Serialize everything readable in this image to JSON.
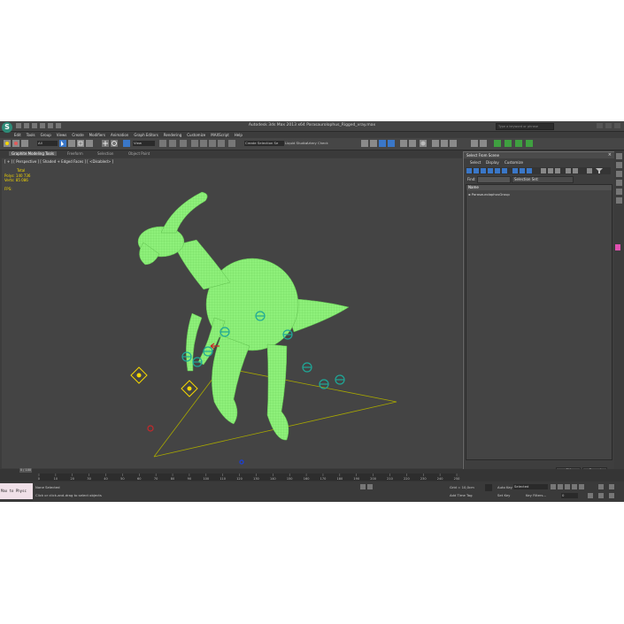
{
  "window": {
    "title": "Autodesk 3ds Max 2013 x64   Parasaurolophus_Rigged_vray.max",
    "search_placeholder": "Type a keyword or phrase"
  },
  "menu": [
    "Edit",
    "Tools",
    "Group",
    "Views",
    "Create",
    "Modifiers",
    "Animation",
    "Graph Editors",
    "Rendering",
    "Customize",
    "MAXScript",
    "Help"
  ],
  "toolbar": {
    "selection_filter": "All",
    "reference_coord": "View",
    "named_selection": "Create Selection Se",
    "extra_label": "Liquid Studio",
    "extra_label2": "Artery Check"
  },
  "ribbon_tabs": [
    "Graphite Modeling Tools",
    "Freeform",
    "Selection",
    "Object Paint"
  ],
  "viewport": {
    "label": "[ + ] [ Perspective ] [ Shaded + Edged Faces ] [ <Disabled> ]",
    "stats": {
      "total_label": "Total",
      "polys_label": "Polys:",
      "polys_value": "140 736",
      "verts_label": "Verts:",
      "verts_value": "85 086",
      "fps_label": "FPS:"
    }
  },
  "timeline": {
    "frame_indicator": "0 / 100",
    "ticks": [
      "0",
      "10",
      "20",
      "30",
      "40",
      "50",
      "60",
      "70",
      "80",
      "90",
      "100",
      "110",
      "120",
      "130",
      "140",
      "150",
      "160",
      "170",
      "180",
      "190",
      "200",
      "210",
      "220",
      "230",
      "240",
      "250"
    ]
  },
  "status": {
    "script_listener": "Max to Physc",
    "selection_info": "None Selected",
    "prompt": "Click or click-and-drag to select objects",
    "grid": "Grid = 10,0cm",
    "add_time_tag": "Add Time Tag",
    "auto_key": "Auto Key",
    "selected": "Selected",
    "set_key": "Set Key",
    "key_filters": "Key Filters...",
    "frame": "0"
  },
  "select_from_scene": {
    "title": "Select From Scene",
    "menu": [
      "Select",
      "Display",
      "Customize"
    ],
    "find_label": "Find:",
    "selection_set_label": "Selection Set:",
    "column_name": "Name",
    "rows": [
      "ParasaurolophusGroup"
    ],
    "ok": "OK",
    "cancel": "Cancel"
  },
  "colors": {
    "app_bg": "#3c3c3c",
    "viewport_bg": "#444444",
    "mesh_green": "#8ef07a",
    "stats_yellow": "#f5d800",
    "control_cyan": "#1ea898"
  }
}
